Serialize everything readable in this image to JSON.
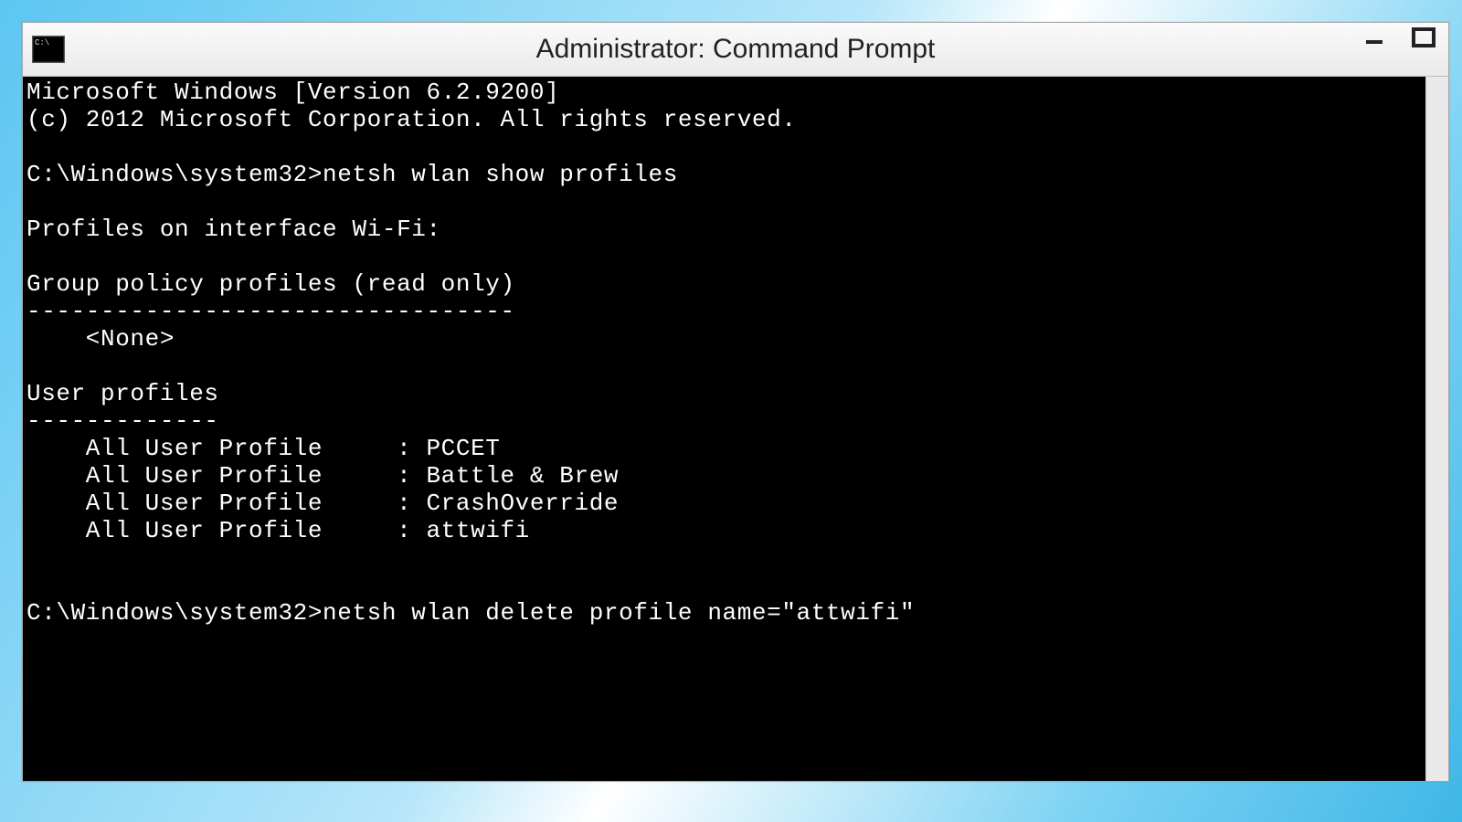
{
  "window": {
    "title": "Administrator: Command Prompt"
  },
  "console": {
    "header1": "Microsoft Windows [Version 6.2.9200]",
    "header2": "(c) 2012 Microsoft Corporation. All rights reserved.",
    "blank": "",
    "prompt1": "C:\\Windows\\system32>netsh wlan show profiles",
    "iface": "Profiles on interface Wi-Fi:",
    "gp_header": "Group policy profiles (read only)",
    "gp_rule": "---------------------------------",
    "gp_none": "    <None>",
    "up_header": "User profiles",
    "up_rule": "-------------",
    "p1": "    All User Profile     : PCCET",
    "p2": "    All User Profile     : Battle & Brew",
    "p3": "    All User Profile     : CrashOverride",
    "p4": "    All User Profile     : attwifi",
    "prompt2": "C:\\Windows\\system32>netsh wlan delete profile name=\"attwifi\""
  }
}
